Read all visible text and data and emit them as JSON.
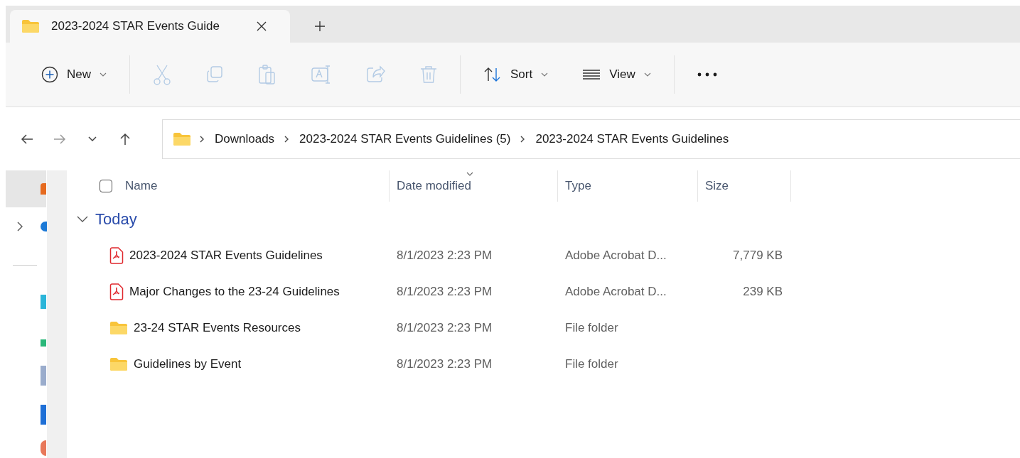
{
  "tab": {
    "title": "2023-2024 STAR Events Guide",
    "selected": true
  },
  "toolbar": [
    [
      {
        "kind": "new",
        "label": "New",
        "dropdown": true,
        "disabled": false
      }
    ],
    [
      {
        "kind": "cut",
        "disabled": true
      },
      {
        "kind": "copy",
        "disabled": true
      },
      {
        "kind": "paste",
        "disabled": true
      },
      {
        "kind": "rename",
        "disabled": true
      },
      {
        "kind": "share",
        "disabled": true
      },
      {
        "kind": "delete",
        "disabled": true
      }
    ],
    [
      {
        "kind": "sort",
        "label": "Sort",
        "dropdown": true,
        "disabled": false
      },
      {
        "kind": "view",
        "label": "View",
        "dropdown": true,
        "disabled": false
      }
    ],
    [
      {
        "kind": "more",
        "disabled": false
      }
    ]
  ],
  "navigation": [
    {
      "kind": "back",
      "disabled": false
    },
    {
      "kind": "forward",
      "disabled": true
    },
    {
      "kind": "recent",
      "disabled": false
    },
    {
      "kind": "up",
      "disabled": false
    }
  ],
  "address": [
    "Downloads",
    "2023-2024 STAR Events Guidelines (5)",
    "2023-2024 STAR Events Guidelines"
  ],
  "columns": [
    {
      "label": "Name",
      "sorted": false
    },
    {
      "label": "Date modified",
      "sorted": true
    },
    {
      "label": "Type",
      "sorted": false
    },
    {
      "label": "Size",
      "sorted": false
    }
  ],
  "select_all": {
    "checked": false
  },
  "group": {
    "label": "Today",
    "expanded": true
  },
  "rows": [
    {
      "kind": "pdf",
      "name": "2023-2024 STAR Events Guidelines",
      "date": "8/1/2023 2:23 PM",
      "type": "Adobe Acrobat D...",
      "size": "7,779 KB"
    },
    {
      "kind": "pdf",
      "name": "Major Changes to the 23-24 Guidelines",
      "date": "8/1/2023 2:23 PM",
      "type": "Adobe Acrobat D...",
      "size": "239 KB"
    },
    {
      "kind": "folder",
      "name": "23-24 STAR Events Resources",
      "date": "8/1/2023 2:23 PM",
      "type": "File folder"
    },
    {
      "kind": "folder",
      "name": "Guidelines by Event",
      "date": "8/1/2023 2:23 PM",
      "type": "File folder"
    }
  ]
}
